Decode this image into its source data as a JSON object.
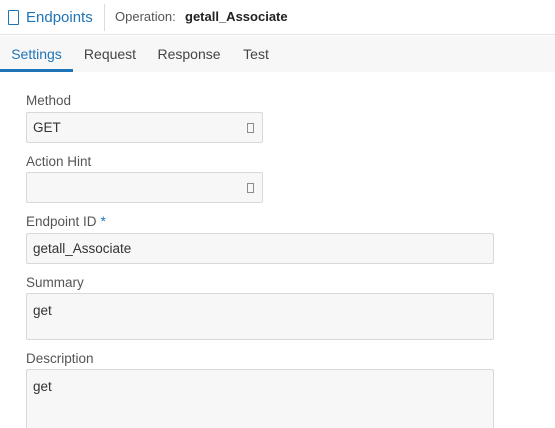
{
  "header": {
    "back_label": "Endpoints",
    "operation_label": "Operation:",
    "operation_value": "getall_Associate"
  },
  "tabs": [
    {
      "label": "Settings",
      "active": true
    },
    {
      "label": "Request",
      "active": false
    },
    {
      "label": "Response",
      "active": false
    },
    {
      "label": "Test",
      "active": false
    }
  ],
  "form": {
    "method": {
      "label": "Method",
      "value": "GET"
    },
    "action_hint": {
      "label": "Action Hint",
      "value": ""
    },
    "endpoint_id": {
      "label": "Endpoint ID",
      "required_mark": "*",
      "value": "getall_Associate"
    },
    "summary": {
      "label": "Summary",
      "value": "get"
    },
    "description": {
      "label": "Description",
      "value": "get"
    }
  },
  "colors": {
    "accent": "#1e74b8",
    "input_bg": "#f7f7f7",
    "tab_bar_bg": "#f7f7f7"
  }
}
